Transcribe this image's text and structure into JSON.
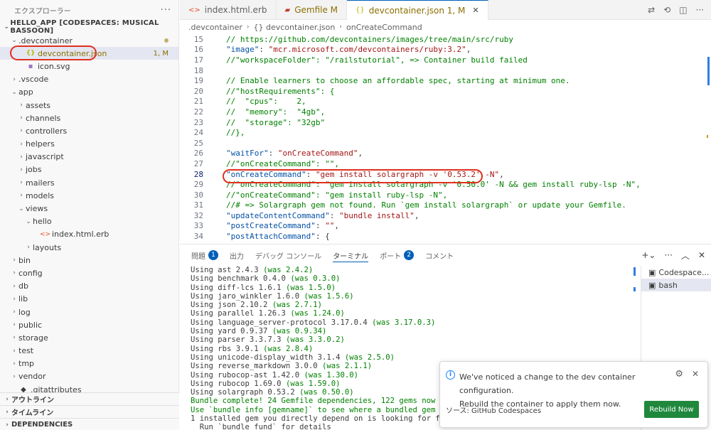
{
  "sidebar": {
    "title": "エクスプローラー",
    "root": "HELLO_APP [CODESPACES: MUSICAL BASSOON]",
    "items": [
      {
        "name": ".devcontainer",
        "depth": 1,
        "type": "folder-open",
        "modified": true
      },
      {
        "name": "devcontainer.json",
        "depth": 2,
        "type": "json",
        "badge": "1, M",
        "selected": true
      },
      {
        "name": "icon.svg",
        "depth": 2,
        "type": "svg"
      },
      {
        "name": ".vscode",
        "depth": 1,
        "type": "folder"
      },
      {
        "name": "app",
        "depth": 1,
        "type": "folder-open"
      },
      {
        "name": "assets",
        "depth": 2,
        "type": "folder"
      },
      {
        "name": "channels",
        "depth": 2,
        "type": "folder"
      },
      {
        "name": "controllers",
        "depth": 2,
        "type": "folder"
      },
      {
        "name": "helpers",
        "depth": 2,
        "type": "folder"
      },
      {
        "name": "javascript",
        "depth": 2,
        "type": "folder"
      },
      {
        "name": "jobs",
        "depth": 2,
        "type": "folder"
      },
      {
        "name": "mailers",
        "depth": 2,
        "type": "folder"
      },
      {
        "name": "models",
        "depth": 2,
        "type": "folder"
      },
      {
        "name": "views",
        "depth": 2,
        "type": "folder-open"
      },
      {
        "name": "hello",
        "depth": 3,
        "type": "folder-open"
      },
      {
        "name": "index.html.erb",
        "depth": 4,
        "type": "html"
      },
      {
        "name": "layouts",
        "depth": 3,
        "type": "folder"
      },
      {
        "name": "bin",
        "depth": 1,
        "type": "folder"
      },
      {
        "name": "config",
        "depth": 1,
        "type": "folder"
      },
      {
        "name": "db",
        "depth": 1,
        "type": "folder"
      },
      {
        "name": "lib",
        "depth": 1,
        "type": "folder"
      },
      {
        "name": "log",
        "depth": 1,
        "type": "folder"
      },
      {
        "name": "public",
        "depth": 1,
        "type": "folder"
      },
      {
        "name": "storage",
        "depth": 1,
        "type": "folder"
      },
      {
        "name": "test",
        "depth": 1,
        "type": "folder"
      },
      {
        "name": "tmp",
        "depth": 1,
        "type": "folder"
      },
      {
        "name": "vendor",
        "depth": 1,
        "type": "folder"
      },
      {
        "name": ".gitattributes",
        "depth": 1,
        "type": "file"
      }
    ],
    "sections": [
      "アウトライン",
      "タイムライン",
      "DEPENDENCIES"
    ]
  },
  "tabs": [
    {
      "icon": "<>",
      "label": "index.html.erb",
      "badge": ""
    },
    {
      "icon": "▰",
      "label": "Gemfile M",
      "badge": ""
    },
    {
      "icon": "{}",
      "label": "devcontainer.json 1, M",
      "badge": "",
      "active": true
    }
  ],
  "breadcrumb": [
    ".devcontainer",
    "{} devcontainer.json",
    "onCreateCommand"
  ],
  "code": [
    {
      "n": 15,
      "t": "  // https://github.com/devcontainers/images/tree/main/src/ruby",
      "k": "com"
    },
    {
      "n": 16,
      "t": "  \"image\": \"mcr.microsoft.com/devcontainers/ruby:3.2\",",
      "k": "kv"
    },
    {
      "n": 17,
      "t": "  //\"workspaceFolder\": \"/railstutorial\", => Container build failed",
      "k": "com"
    },
    {
      "n": 18,
      "t": "",
      "k": "plain"
    },
    {
      "n": 19,
      "t": "  // Enable learners to choose an affordable spec, starting at minimum one.",
      "k": "com"
    },
    {
      "n": 20,
      "t": "  //\"hostRequirements\": {",
      "k": "com"
    },
    {
      "n": 21,
      "t": "  //  \"cpus\":    2,",
      "k": "com"
    },
    {
      "n": 22,
      "t": "  //  \"memory\":  \"4gb\",",
      "k": "com"
    },
    {
      "n": 23,
      "t": "  //  \"storage\": \"32gb\"",
      "k": "com"
    },
    {
      "n": 24,
      "t": "  //},",
      "k": "com"
    },
    {
      "n": 25,
      "t": "",
      "k": "plain"
    },
    {
      "n": 26,
      "t": "  \"waitFor\": \"onCreateCommand\",",
      "k": "kv"
    },
    {
      "n": 27,
      "t": "  //\"onCreateCommand\": \"\",",
      "k": "com"
    },
    {
      "n": 28,
      "t": "  \"onCreateCommand\": \"gem install solargraph -v '0.53.2' -N\",",
      "k": "kv",
      "current": true
    },
    {
      "n": 29,
      "t": "  //\"onCreateCommand\": \"gem install solargraph -v '0.50.0' -N && gem install ruby-lsp -N\",",
      "k": "com"
    },
    {
      "n": 30,
      "t": "  //\"onCreateCommand\": \"gem install ruby-lsp -N\",",
      "k": "com"
    },
    {
      "n": 31,
      "t": "  //# => Solargraph gem not found. Run `gem install solargraph` or update your Gemfile.",
      "k": "com"
    },
    {
      "n": 32,
      "t": "  \"updateContentCommand\": \"bundle install\",",
      "k": "kv"
    },
    {
      "n": 33,
      "t": "  \"postCreateCommand\": \"\",",
      "k": "kv"
    },
    {
      "n": 34,
      "t": "  \"postAttachCommand\": {",
      "k": "kv"
    }
  ],
  "panel": {
    "tabs": [
      {
        "label": "問題",
        "badge": "1"
      },
      {
        "label": "出力",
        "badge": ""
      },
      {
        "label": "デバッグ コンソール",
        "badge": ""
      },
      {
        "label": "ターミナル",
        "badge": "",
        "active": true
      },
      {
        "label": "ポート",
        "badge": "2"
      },
      {
        "label": "コメント",
        "badge": ""
      }
    ],
    "terminal_lines": [
      {
        "main": "Using ast 2.4.3 ",
        "was": "(was 2.4.2)"
      },
      {
        "main": "Using benchmark 0.4.0 ",
        "was": "(was 0.3.0)"
      },
      {
        "main": "Using diff-lcs 1.6.1 ",
        "was": "(was 1.5.0)"
      },
      {
        "main": "Using jaro_winkler 1.6.0 ",
        "was": "(was 1.5.6)"
      },
      {
        "main": "Using json 2.10.2 ",
        "was": "(was 2.7.1)"
      },
      {
        "main": "Using parallel 1.26.3 ",
        "was": "(was 1.24.0)"
      },
      {
        "main": "Using language_server-protocol 3.17.0.4 ",
        "was": "(was 3.17.0.3)"
      },
      {
        "main": "Using yard 0.9.37 ",
        "was": "(was 0.9.34)"
      },
      {
        "main": "Using parser 3.3.7.3 ",
        "was": "(was 3.3.0.2)"
      },
      {
        "main": "Using rbs 3.9.1 ",
        "was": "(was 2.8.4)"
      },
      {
        "main": "Using unicode-display_width 3.1.4 ",
        "was": "(was 2.5.0)"
      },
      {
        "main": "Using reverse_markdown 3.0.0 ",
        "was": "(was 2.1.1)"
      },
      {
        "main": "Using rubocop-ast 1.42.0 ",
        "was": "(was 1.30.0)"
      },
      {
        "main": "Using rubocop 1.69.0 ",
        "was": "(was 1.59.0)"
      },
      {
        "main": "Using solargraph 0.53.2 ",
        "was": "(was 0.50.0)"
      },
      {
        "main": "",
        "was": "Bundle complete! 24 Gemfile dependencies, 122 gems now insta"
      },
      {
        "main": "",
        "was": "Use `bundle info [gemname]` to see where a bundled gem is in"
      },
      {
        "main": "1 installed gem you directly depend on is looking for fundin",
        "was": ""
      },
      {
        "main": "  Run `bundle fund` for details",
        "was": ""
      }
    ],
    "prompt": {
      "arrow": "→",
      "path": "/workspaces/hello_app",
      "branch": "(main)",
      "suffix": " $ ▯"
    },
    "terminals": [
      "Codespace...",
      "bash"
    ]
  },
  "notification": {
    "line1": "We've noticed a change to the dev container configuration.",
    "line2": "Rebuild the container to apply them now.",
    "source": "ソース: GitHub Codespaces",
    "button": "Rebuild Now"
  }
}
